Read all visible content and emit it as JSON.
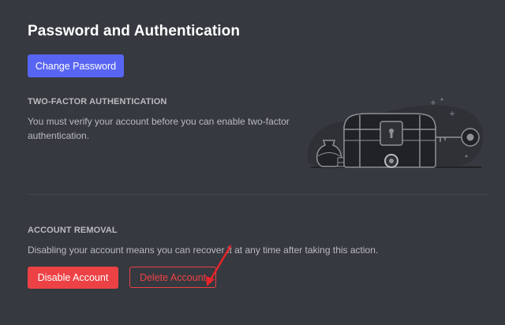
{
  "page": {
    "title": "Password and Authentication"
  },
  "password": {
    "change_label": "Change Password"
  },
  "two_factor": {
    "heading": "TWO-FACTOR AUTHENTICATION",
    "description": "You must verify your account before you can enable two-factor authentication.",
    "illustration_icon": "locked-chest-key-illustration"
  },
  "account_removal": {
    "heading": "ACCOUNT REMOVAL",
    "description": "Disabling your account means you can recover it at any time after taking this action.",
    "disable_label": "Disable Account",
    "delete_label": "Delete Account"
  },
  "colors": {
    "background": "#36393f",
    "primary": "#5865f2",
    "danger": "#ed4245",
    "annotation": "#e8232a"
  }
}
